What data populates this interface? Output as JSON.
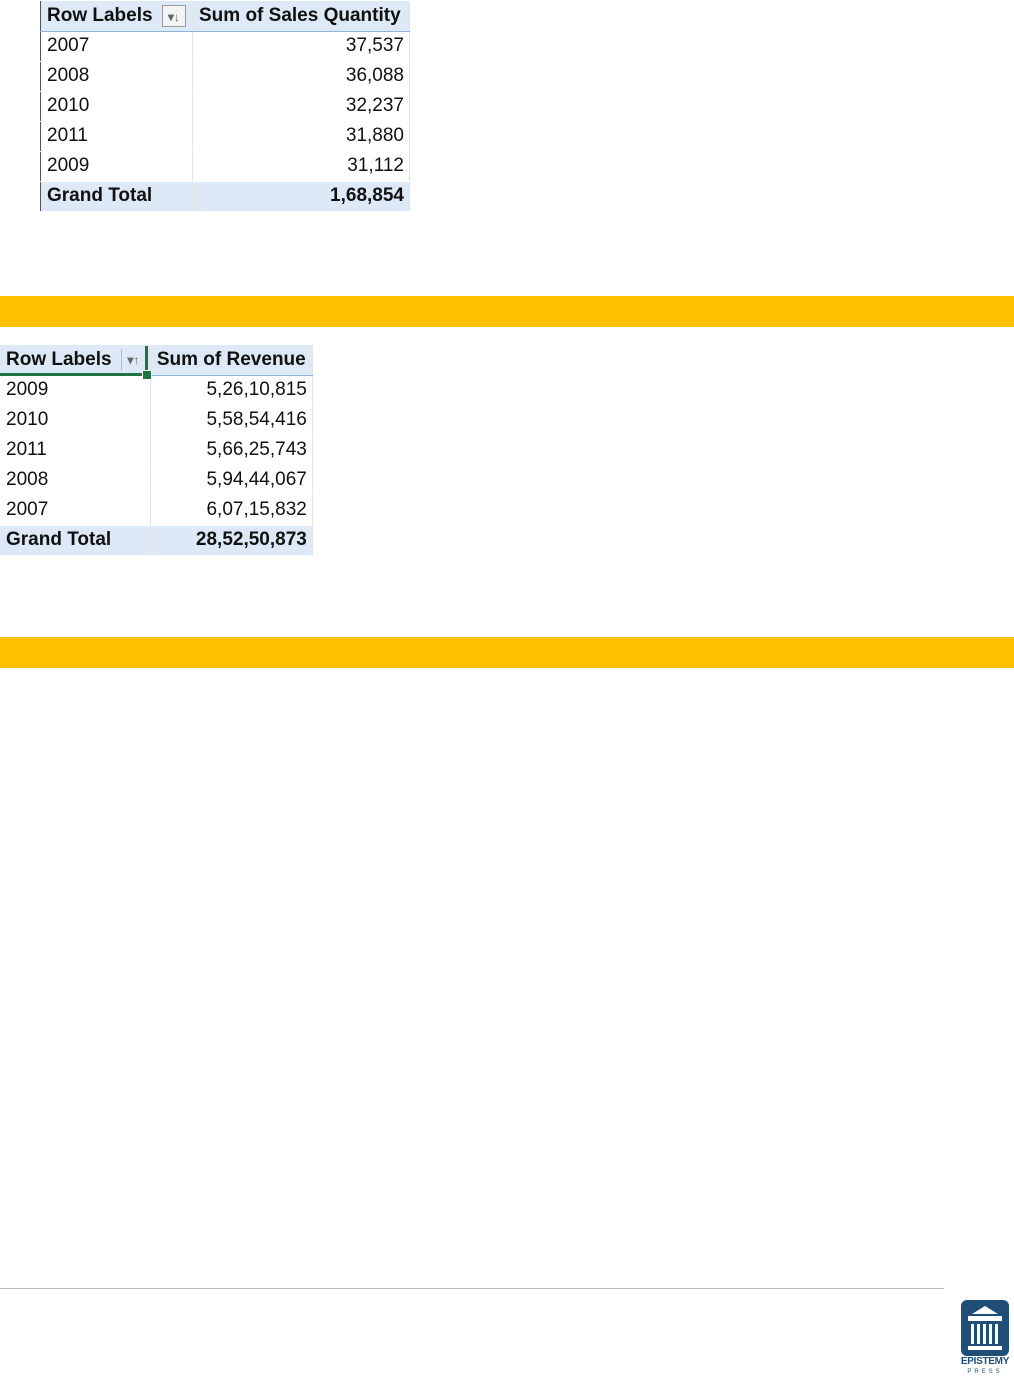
{
  "pivot_quantity": {
    "header": {
      "row_labels": "Row Labels",
      "value_label": "Sum of Sales Quantity",
      "sort_icon": "sort-descending-icon"
    },
    "rows": [
      {
        "label": "2007",
        "value": "37,537"
      },
      {
        "label": "2008",
        "value": "36,088"
      },
      {
        "label": "2010",
        "value": "32,237"
      },
      {
        "label": "2011",
        "value": "31,880"
      },
      {
        "label": "2009",
        "value": "31,112"
      }
    ],
    "total": {
      "label": "Grand Total",
      "value": "1,68,854"
    }
  },
  "pivot_revenue": {
    "header": {
      "row_labels": "Row Labels",
      "value_label": "Sum of Revenue",
      "sort_icon": "sort-ascending-icon"
    },
    "rows": [
      {
        "label": "2009",
        "value": "5,26,10,815"
      },
      {
        "label": "2010",
        "value": "5,58,54,416"
      },
      {
        "label": "2011",
        "value": "5,66,25,743"
      },
      {
        "label": "2008",
        "value": "5,94,44,067"
      },
      {
        "label": "2007",
        "value": "6,07,15,832"
      }
    ],
    "total": {
      "label": "Grand Total",
      "value": "28,52,50,873"
    }
  },
  "colors": {
    "band": "#ffc000",
    "pivot_header": "#dde9f6",
    "selection": "#217346",
    "logo": "#1f4e78"
  },
  "footer": {
    "logo_text": "EPISTEMY",
    "logo_subtext": "PRESS"
  }
}
